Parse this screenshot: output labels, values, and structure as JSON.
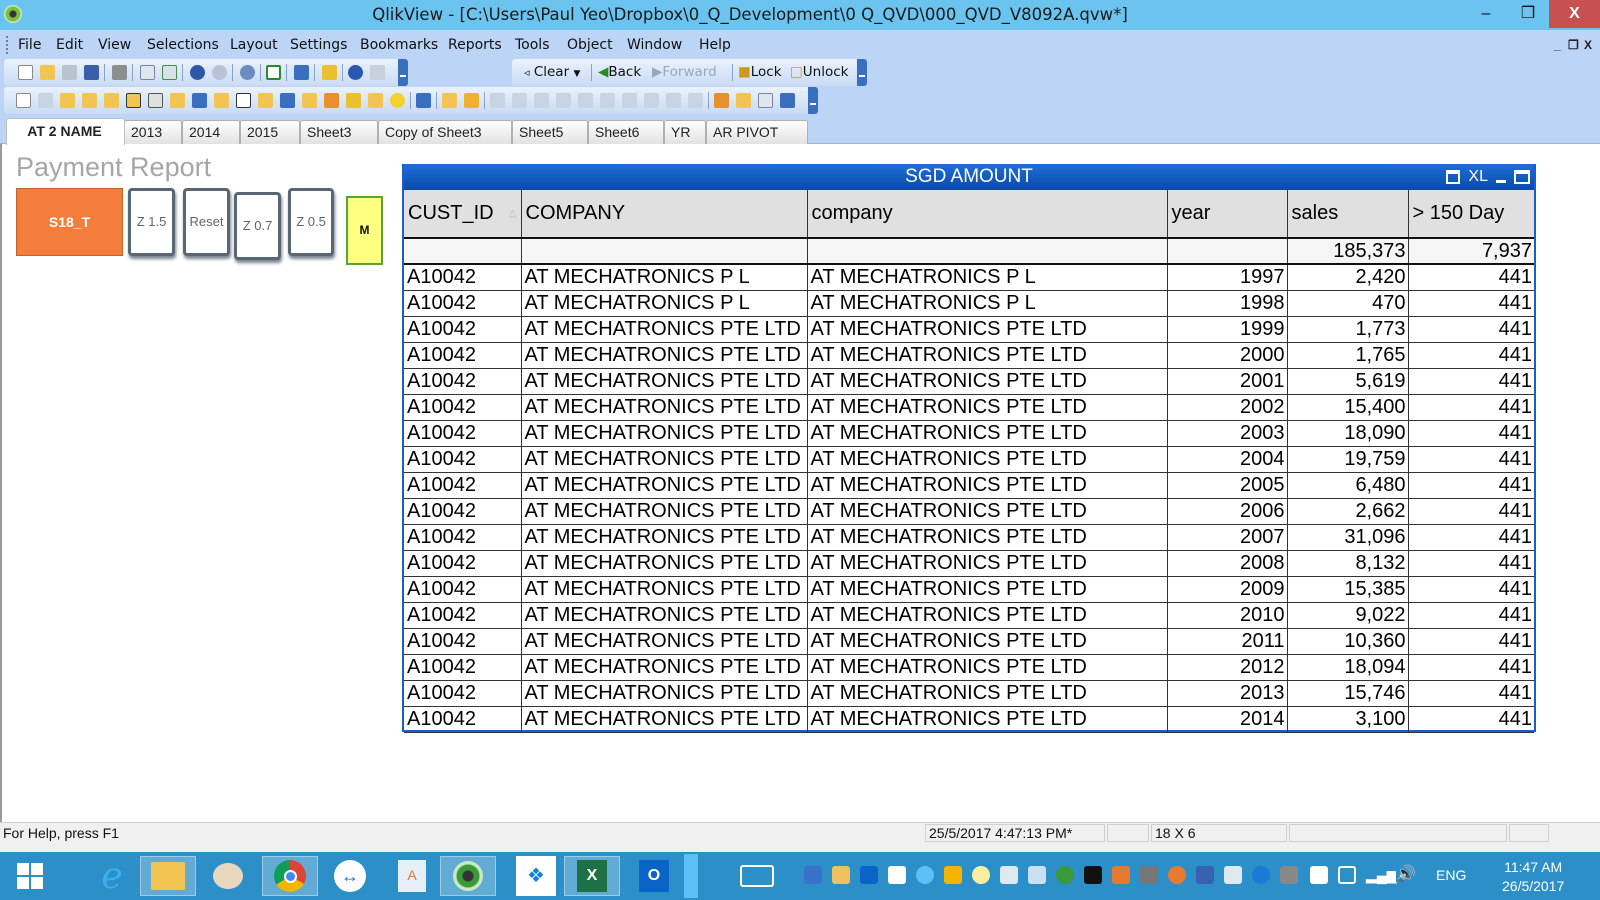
{
  "window": {
    "title": "QlikView - [C:\\Users\\Paul Yeo\\Dropbox\\0_Q_Development\\0 Q_QVD\\000_QVD_V8092A.qvw*]",
    "controls": {
      "minimize": "–",
      "maximize": "❒",
      "close": "X"
    }
  },
  "menu": {
    "items": [
      {
        "label": "File",
        "accel": "F"
      },
      {
        "label": "Edit",
        "accel": "E"
      },
      {
        "label": "View",
        "accel": "V"
      },
      {
        "label": "Selections",
        "accel": "c"
      },
      {
        "label": "Layout",
        "accel": "L"
      },
      {
        "label": "Settings",
        "accel": "S"
      },
      {
        "label": "Bookmarks",
        "accel": "B"
      },
      {
        "label": "Reports",
        "accel": "R"
      },
      {
        "label": "Tools",
        "accel": "T"
      },
      {
        "label": "Object",
        "accel": "O"
      },
      {
        "label": "Window",
        "accel": "W"
      },
      {
        "label": "Help",
        "accel": "H"
      }
    ],
    "mdi_controls": {
      "minimize": "_",
      "restore": "❐",
      "close": "X"
    }
  },
  "toolbar": {
    "navigation": {
      "clear": "Clear",
      "back": "Back",
      "forward": "Forward",
      "lock": "Lock",
      "unlock": "Unlock"
    }
  },
  "tabs": [
    {
      "label": "AT 2 NAME",
      "active": true
    },
    {
      "label": "2013"
    },
    {
      "label": "2014"
    },
    {
      "label": "2015"
    },
    {
      "label": "Sheet3"
    },
    {
      "label": "Copy of Sheet3"
    },
    {
      "label": "Sheet5"
    },
    {
      "label": "Sheet6"
    },
    {
      "label": "YR"
    },
    {
      "label": "AR PIVOT"
    }
  ],
  "sheet": {
    "title": "Payment Report",
    "buttons": [
      {
        "label": "S18_T",
        "style": "orange",
        "color": "#f47c3c"
      },
      {
        "label": "Z 1.5",
        "style": "grey"
      },
      {
        "label": "Reset",
        "style": "grey"
      },
      {
        "label": "Z 0.7",
        "style": "grey"
      },
      {
        "label": "Z 0.5",
        "style": "grey"
      },
      {
        "label": "M",
        "style": "yellow",
        "color": "#ffff80"
      }
    ]
  },
  "table": {
    "caption": "SGD AMOUNT",
    "caption_icons": [
      "print-icon",
      "XL",
      "minimize-icon",
      "maximize-icon"
    ],
    "xl_label": "XL",
    "columns": [
      "CUST_ID",
      "COMPANY",
      "company",
      "year",
      "sales",
      "> 150 Day"
    ],
    "totals": {
      "sales": "185,373",
      "over150": "7,937"
    },
    "rows": [
      {
        "cust_id": "A10042",
        "COMPANY": "AT MECHATRONICS P L",
        "company": "AT MECHATRONICS P L",
        "year": "1997",
        "sales": "2,420",
        "over150": "441"
      },
      {
        "cust_id": "A10042",
        "COMPANY": "AT MECHATRONICS P L",
        "company": "AT MECHATRONICS P L",
        "year": "1998",
        "sales": "470",
        "over150": "441"
      },
      {
        "cust_id": "A10042",
        "COMPANY": "AT MECHATRONICS PTE LTD",
        "company": "AT MECHATRONICS PTE LTD",
        "year": "1999",
        "sales": "1,773",
        "over150": "441"
      },
      {
        "cust_id": "A10042",
        "COMPANY": "AT MECHATRONICS PTE LTD",
        "company": "AT MECHATRONICS PTE LTD",
        "year": "2000",
        "sales": "1,765",
        "over150": "441"
      },
      {
        "cust_id": "A10042",
        "COMPANY": "AT MECHATRONICS PTE LTD",
        "company": "AT MECHATRONICS PTE LTD",
        "year": "2001",
        "sales": "5,619",
        "over150": "441"
      },
      {
        "cust_id": "A10042",
        "COMPANY": "AT MECHATRONICS PTE LTD",
        "company": "AT MECHATRONICS PTE LTD",
        "year": "2002",
        "sales": "15,400",
        "over150": "441"
      },
      {
        "cust_id": "A10042",
        "COMPANY": "AT MECHATRONICS PTE LTD",
        "company": "AT MECHATRONICS PTE LTD",
        "year": "2003",
        "sales": "18,090",
        "over150": "441"
      },
      {
        "cust_id": "A10042",
        "COMPANY": "AT MECHATRONICS PTE LTD",
        "company": "AT MECHATRONICS PTE LTD",
        "year": "2004",
        "sales": "19,759",
        "over150": "441"
      },
      {
        "cust_id": "A10042",
        "COMPANY": "AT MECHATRONICS PTE LTD",
        "company": "AT MECHATRONICS PTE LTD",
        "year": "2005",
        "sales": "6,480",
        "over150": "441"
      },
      {
        "cust_id": "A10042",
        "COMPANY": "AT MECHATRONICS PTE LTD",
        "company": "AT MECHATRONICS PTE LTD",
        "year": "2006",
        "sales": "2,662",
        "over150": "441"
      },
      {
        "cust_id": "A10042",
        "COMPANY": "AT MECHATRONICS PTE LTD",
        "company": "AT MECHATRONICS PTE LTD",
        "year": "2007",
        "sales": "31,096",
        "over150": "441"
      },
      {
        "cust_id": "A10042",
        "COMPANY": "AT MECHATRONICS PTE LTD",
        "company": "AT MECHATRONICS PTE LTD",
        "year": "2008",
        "sales": "8,132",
        "over150": "441"
      },
      {
        "cust_id": "A10042",
        "COMPANY": "AT MECHATRONICS PTE LTD",
        "company": "AT MECHATRONICS PTE LTD",
        "year": "2009",
        "sales": "15,385",
        "over150": "441"
      },
      {
        "cust_id": "A10042",
        "COMPANY": "AT MECHATRONICS PTE LTD",
        "company": "AT MECHATRONICS PTE LTD",
        "year": "2010",
        "sales": "9,022",
        "over150": "441"
      },
      {
        "cust_id": "A10042",
        "COMPANY": "AT MECHATRONICS PTE LTD",
        "company": "AT MECHATRONICS PTE LTD",
        "year": "2011",
        "sales": "10,360",
        "over150": "441"
      },
      {
        "cust_id": "A10042",
        "COMPANY": "AT MECHATRONICS PTE LTD",
        "company": "AT MECHATRONICS PTE LTD",
        "year": "2012",
        "sales": "18,094",
        "over150": "441"
      },
      {
        "cust_id": "A10042",
        "COMPANY": "AT MECHATRONICS PTE LTD",
        "company": "AT MECHATRONICS PTE LTD",
        "year": "2013",
        "sales": "15,746",
        "over150": "441"
      },
      {
        "cust_id": "A10042",
        "COMPANY": "AT MECHATRONICS PTE LTD",
        "company": "AT MECHATRONICS PTE LTD",
        "year": "2014",
        "sales": "3,100",
        "over150": "441"
      }
    ]
  },
  "statusbar": {
    "help": "For Help, press F1",
    "timestamp": "25/5/2017 4:47:13 PM*",
    "dimensions": "18 X 6"
  },
  "taskbar": {
    "apps": [
      "start-icon",
      "internet-explorer-icon",
      "file-explorer-icon",
      "paint-icon",
      "chrome-icon",
      "teamviewer-icon",
      "wordpad-icon",
      "qlikview-icon",
      "dropbox-icon",
      "excel-icon",
      "outlook-icon"
    ],
    "language": "ENG",
    "time": "11:47 AM",
    "date": "26/5/2017"
  },
  "colors": {
    "titlebar": "#6bc4ef",
    "menubar": "#bcd4f6",
    "table_caption": "#1a5fc8",
    "taskbar": "#2c8fc7"
  }
}
